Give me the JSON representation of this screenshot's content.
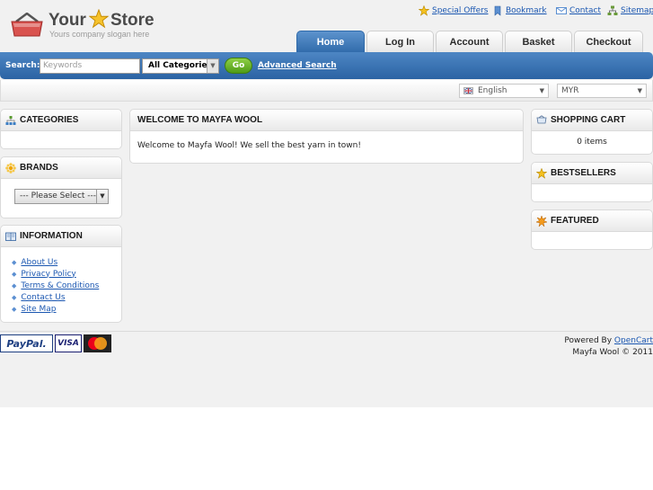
{
  "logo": {
    "word1": "Your",
    "word2": "Store",
    "slogan": "Yours company slogan here"
  },
  "top_links": [
    {
      "label": "Special Offers",
      "icon": "star-icon"
    },
    {
      "label": "Bookmark",
      "icon": "bookmark-icon"
    },
    {
      "label": "Contact",
      "icon": "mail-icon"
    },
    {
      "label": "Sitemap",
      "icon": "sitemap-icon"
    }
  ],
  "tabs": [
    {
      "label": "Home",
      "active": true
    },
    {
      "label": "Log In"
    },
    {
      "label": "Account"
    },
    {
      "label": "Basket"
    },
    {
      "label": "Checkout"
    }
  ],
  "search": {
    "label": "Search:",
    "placeholder": "Keywords",
    "category": "All Categories",
    "go": "Go",
    "advanced": "Advanced Search"
  },
  "language": {
    "selected": "English"
  },
  "currency": {
    "selected": "MYR"
  },
  "categories": {
    "title": "CATEGORIES"
  },
  "brands": {
    "title": "BRANDS",
    "select": "--- Please Select ---"
  },
  "information": {
    "title": "INFORMATION",
    "links": [
      "About Us",
      "Privacy Policy",
      "Terms & Conditions",
      "Contact Us",
      "Site Map"
    ]
  },
  "main": {
    "title": "WELCOME TO MAYFA WOOL",
    "text": "Welcome to Mayfa Wool! We sell the best yarn in town!"
  },
  "cart": {
    "title": "SHOPPING CART",
    "items": "0 items"
  },
  "bestsellers": {
    "title": "BESTSELLERS"
  },
  "featured": {
    "title": "FEATURED"
  },
  "footer": {
    "powered_prefix": "Powered By",
    "powered_link": "OpenCart",
    "copyright": "Mayfa Wool © 2011",
    "cards": [
      "PayPal.",
      "VISA",
      "MasterCard"
    ]
  },
  "colors": {
    "accent": "#2f6aaa",
    "go_button": "#5fa61f",
    "link": "#1b57b1"
  }
}
